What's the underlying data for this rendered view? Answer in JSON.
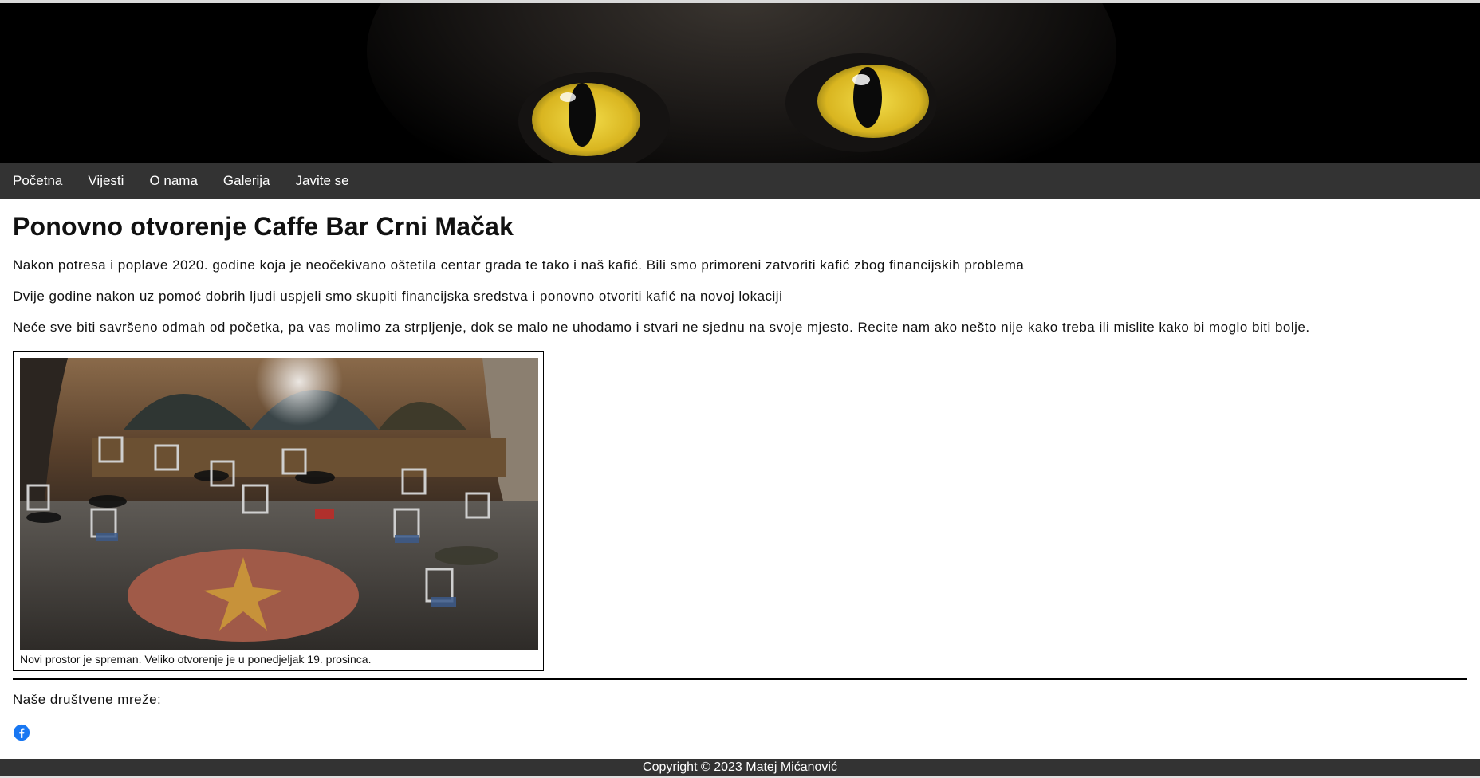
{
  "nav": {
    "items": [
      {
        "label": "Početna"
      },
      {
        "label": "Vijesti"
      },
      {
        "label": "O nama"
      },
      {
        "label": "Galerija"
      },
      {
        "label": "Javite se"
      }
    ]
  },
  "article": {
    "title": "Ponovno otvorenje Caffe Bar Crni Mačak",
    "paragraphs": [
      "Nakon potresa i poplave 2020. godine koja je neočekivano oštetila centar grada te tako i naš kafić. Bili smo primoreni zatvoriti kafić zbog financijskih problema",
      "Dvije godine nakon uz pomoć dobrih ljudi uspjeli smo skupiti financijska sredstva i ponovno otvoriti kafić na novoj lokaciji",
      "Neće sve biti savršeno odmah od početka, pa vas molimo za strpljenje, dok se malo ne uhodamo i stvari ne sjednu na svoje mjesto. Recite nam ako nešto nije kako treba ili mislite kako bi moglo biti bolje."
    ],
    "figure": {
      "caption": "Novi prostor je spreman. Veliko otvorenje je u ponedjeljak 19. prosinca."
    }
  },
  "social": {
    "title": "Naše društvene mreže:",
    "icons": [
      "facebook-icon"
    ],
    "facebook_color": "#1877f2"
  },
  "footer": {
    "text": "Copyright © 2023 Matej Mićanović"
  },
  "colors": {
    "nav_bg": "#333333",
    "footer_bg": "#333333",
    "banner_bg": "#000000",
    "eye_yellow": "#e6c32a"
  }
}
